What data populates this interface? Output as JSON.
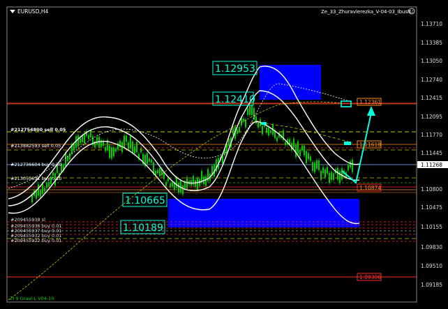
{
  "window": {
    "symbol_title": "EURUSD,H4",
    "indicator_title": "Ze_33_Zhuravlerezka_V-04-03_Ibush",
    "footer_label": "ZI 9 Graal-L V04-10"
  },
  "icons": {
    "menu": "triangle-down-icon",
    "smiley": "smiley-icon"
  },
  "colors": {
    "background": "#000000",
    "candles": "#00cc00",
    "bands": "#ffffff",
    "zone": "#0000ff",
    "accent_cyan": "#00ffdd",
    "level_red": "#ff2a2a",
    "level_orange": "#ff8c1a",
    "level_yellow": "#c8c800",
    "current_price": "#8ab4ff"
  },
  "price_axis": {
    "ticks": [
      "1.13710",
      "1.13385",
      "1.13050",
      "1.12740",
      "1.12415",
      "1.12095",
      "1.11770",
      "1.11445",
      "1.11120",
      "1.10800",
      "1.10475",
      "1.10155",
      "1.09830",
      "1.09510",
      "1.09185"
    ],
    "current_price": "1.11268"
  },
  "big_labels": {
    "high1": "1.12953",
    "high2": "1.12410",
    "low1": "1.10665",
    "low2": "1.10189"
  },
  "boxed_levels": {
    "top": "1.12361",
    "middle": "1.11618",
    "lower": "1.10874",
    "bottom": "1.09306"
  },
  "order_labels": {
    "sell1": "#212754800 sell 0.05",
    "sell2": "#213882593 sell 0.05",
    "buy1": "#212736604 buy 0.30",
    "buy2": "#213055631 buy 0.10",
    "stack": [
      "#209455938 sl",
      "#209455936 buy 0.01",
      "#209455937 buy 0.01",
      "#209455932 buy 0.01",
      "#209455922 buy 0.01"
    ]
  }
}
